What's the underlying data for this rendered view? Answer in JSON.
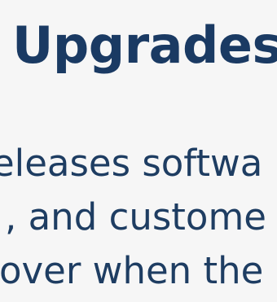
{
  "heading": "Upgrades",
  "body_lines": [
    "eleases softwa",
    ", and custome",
    "over when the"
  ]
}
